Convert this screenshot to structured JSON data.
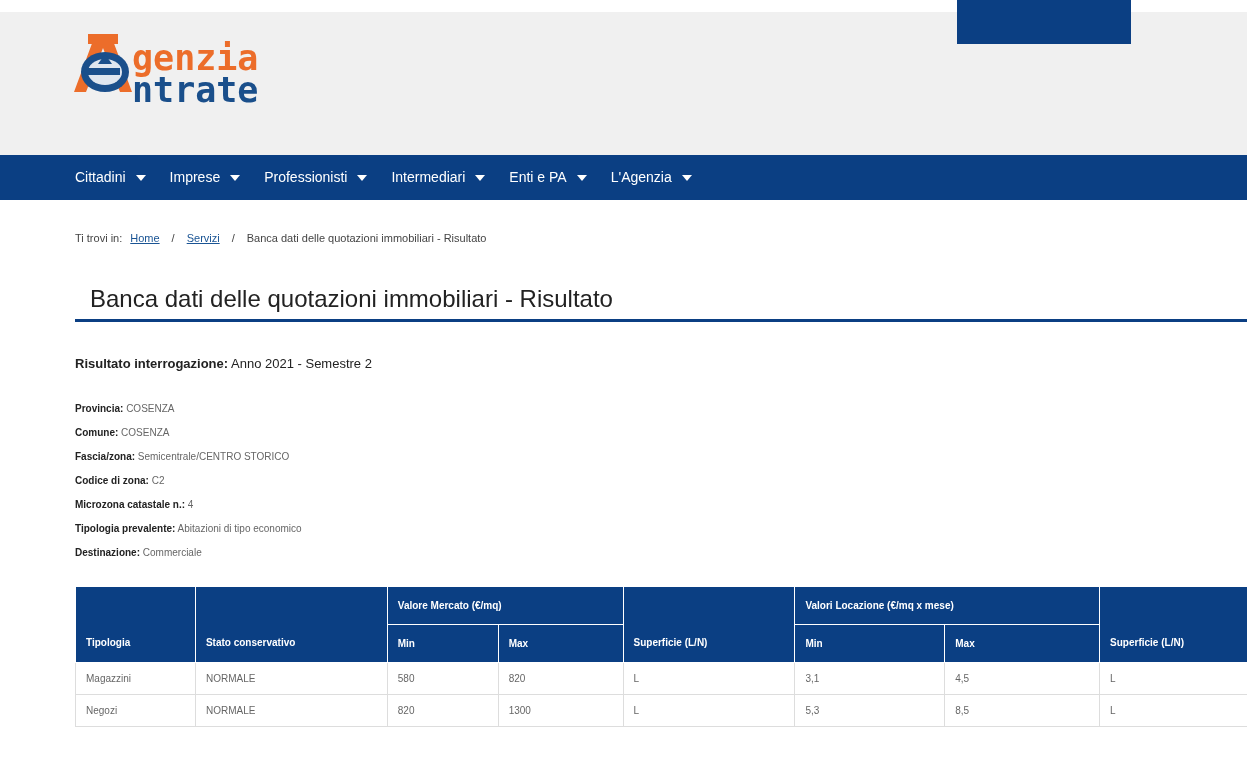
{
  "header": {
    "logo": {
      "top": "genzia",
      "bottom": "ntrate"
    }
  },
  "nav": [
    {
      "label": "Cittadini"
    },
    {
      "label": "Imprese"
    },
    {
      "label": "Professionisti"
    },
    {
      "label": "Intermediari"
    },
    {
      "label": "Enti e PA"
    },
    {
      "label": "L'Agenzia"
    }
  ],
  "breadcrumb": {
    "prefix": "Ti trovi in:",
    "items": [
      {
        "label": "Home",
        "kind": "link"
      },
      {
        "label": "Servizi",
        "kind": "link"
      },
      {
        "label": "Banca dati delle quotazioni immobiliari - Risultato",
        "kind": "current"
      }
    ],
    "separator": "/"
  },
  "title": "Banca dati delle quotazioni immobiliari - Risultato",
  "result": {
    "label": "Risultato interrogazione:",
    "value": "Anno 2021 - Semestre 2"
  },
  "details": [
    {
      "label": "Provincia:",
      "value": "COSENZA"
    },
    {
      "label": "Comune:",
      "value": "COSENZA"
    },
    {
      "label": "Fascia/zona:",
      "value": "Semicentrale/CENTRO STORICO"
    },
    {
      "label": "Codice di zona:",
      "value": "C2"
    },
    {
      "label": "Microzona catastale n.:",
      "value": "4"
    },
    {
      "label": "Tipologia prevalente:",
      "value": "Abitazioni di tipo economico"
    },
    {
      "label": "Destinazione:",
      "value": "Commerciale"
    }
  ],
  "table": {
    "groups": [
      {
        "label": "Tipologia"
      },
      {
        "label": "Stato conservativo"
      },
      {
        "label": "Valore Mercato (€/mq)",
        "columns": [
          "Min",
          "Max"
        ]
      },
      {
        "label": "Superficie (L/N)"
      },
      {
        "label": "Valori Locazione (€/mq x mese)",
        "columns": [
          "Min",
          "Max"
        ]
      },
      {
        "label": "Superficie (L/N)"
      }
    ],
    "rows": [
      [
        "Magazzini",
        "NORMALE",
        "580",
        "820",
        "L",
        "3,1",
        "4,5",
        "L"
      ],
      [
        "Negozi",
        "NORMALE",
        "820",
        "1300",
        "L",
        "5,3",
        "8,5",
        "L"
      ]
    ]
  }
}
